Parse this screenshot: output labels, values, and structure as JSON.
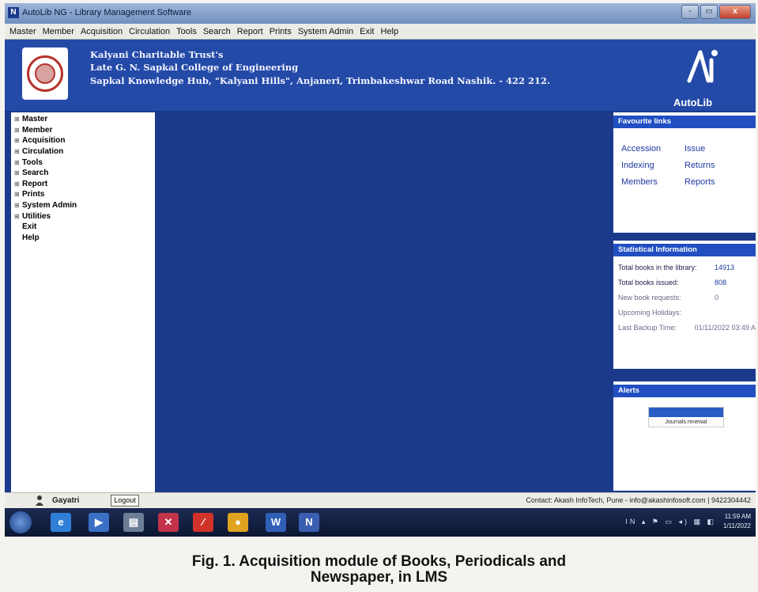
{
  "window": {
    "title": "AutoLib NG - Library Management Software",
    "app_icon": "N",
    "controls": {
      "minimize": "-",
      "maximize": "▭",
      "close": "x"
    }
  },
  "menubar": {
    "items": [
      "Master",
      "Member",
      "Acquisition",
      "Circulation",
      "Tools",
      "Search",
      "Report",
      "Prints",
      "System Admin",
      "Exit",
      "Help"
    ]
  },
  "header": {
    "trust": "Kalyani Charitable Trust's",
    "college": "Late G. N. Sapkal College of Engineering",
    "address": "Sapkal Knowledge Hub, \"Kalyani Hills\", Anjaneri, Trimbakeshwar Road Nashik. - 422 212.",
    "brand": "AutoLib",
    "logo_icon": "college-seal-icon"
  },
  "sidebar": {
    "items": [
      {
        "label": "Master",
        "expandable": true
      },
      {
        "label": "Member",
        "expandable": true
      },
      {
        "label": "Acquisition",
        "expandable": true
      },
      {
        "label": "Circulation",
        "expandable": true
      },
      {
        "label": "Tools",
        "expandable": true
      },
      {
        "label": "Search",
        "expandable": true
      },
      {
        "label": "Report",
        "expandable": true
      },
      {
        "label": "Prints",
        "expandable": true
      },
      {
        "label": "System Admin",
        "expandable": true
      },
      {
        "label": "Utilities",
        "expandable": true
      },
      {
        "label": "Exit",
        "expandable": false
      },
      {
        "label": "Help",
        "expandable": false
      }
    ],
    "expander_glyph": "⊞"
  },
  "favourites": {
    "title": "Favourite links",
    "links": [
      "Accession",
      "Issue",
      "Indexing",
      "Returns",
      "Members",
      "Reports"
    ]
  },
  "stats": {
    "title": "Statistical Information",
    "rows": [
      {
        "label": "Total books in the library:",
        "value": "14913"
      },
      {
        "label": "Total books issued:",
        "value": "808"
      },
      {
        "label": "New book requests:",
        "value": "0"
      },
      {
        "label": "Upcoming Holidays:",
        "value": ""
      },
      {
        "label": "Last Backup Time:",
        "value": "01/11/2022 03:49 A"
      }
    ]
  },
  "alerts": {
    "title": "Alerts",
    "items": [
      "Journals renewal"
    ]
  },
  "statusbar": {
    "user": "Gayatri",
    "logout": "Logout",
    "contact": "Contact: Akash InfoTech, Pune - info@akashinfosoft.com | 9422304442"
  },
  "taskbar": {
    "apps": [
      {
        "icon": "start-orb-icon",
        "glyph": ""
      },
      {
        "icon": "internet-explorer-icon",
        "glyph": "e",
        "color": "#2f7fd6"
      },
      {
        "icon": "media-player-icon",
        "glyph": "▶",
        "color": "#3a6fc4"
      },
      {
        "icon": "save-disk-icon",
        "glyph": "▤",
        "color": "#6c7d96"
      },
      {
        "icon": "tools-icon",
        "glyph": "✕",
        "color": "#c2324a"
      },
      {
        "icon": "pdf-reader-icon",
        "glyph": "⁄",
        "color": "#d1332a"
      },
      {
        "icon": "chrome-icon",
        "glyph": "●",
        "color": "#e0a320"
      },
      {
        "icon": "word-icon",
        "glyph": "W",
        "color": "#2f5fb6"
      },
      {
        "icon": "autolib-icon",
        "glyph": "N",
        "color": "#3b5fb0"
      }
    ],
    "time": "11:59 AM",
    "date": "1/11/2022"
  },
  "caption": {
    "line1": "Fig. 1. Acquisition module of Books, Periodicals and",
    "line2": "Newspaper, in LMS"
  },
  "colors": {
    "workspace": "#1b3a8c",
    "header": "#244aa8",
    "panel_head": "#214fc2",
    "link": "#1d3aa0"
  }
}
